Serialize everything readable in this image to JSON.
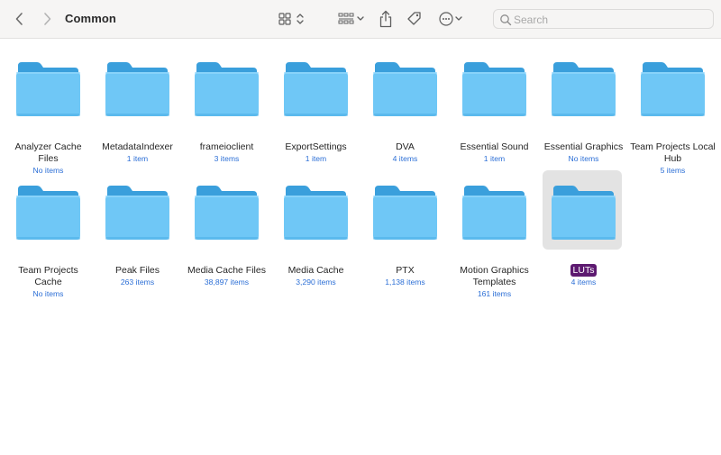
{
  "toolbar": {
    "title": "Common",
    "search_placeholder": "Search",
    "icons": {
      "back": "chevron-left-icon",
      "forward": "chevron-right-icon",
      "view": "grid-view-icon",
      "group": "group-by-icon",
      "share": "share-icon",
      "tag": "tag-icon",
      "more": "ellipsis-circle-icon",
      "search": "search-icon"
    }
  },
  "colors": {
    "folder_front": "#6fc7f6",
    "folder_back": "#3a9fdc",
    "count_text": "#2c6fd6",
    "selection_label": "#5d1a70"
  },
  "folders": [
    {
      "name": "Analyzer Cache Files",
      "count": "No items"
    },
    {
      "name": "MetadataIndexer",
      "count": "1 item"
    },
    {
      "name": "frameioclient",
      "count": "3 items"
    },
    {
      "name": "ExportSettings",
      "count": "1 item"
    },
    {
      "name": "DVA",
      "count": "4 items"
    },
    {
      "name": "Essential Sound",
      "count": "1 item"
    },
    {
      "name": "Essential Graphics",
      "count": "No items"
    },
    {
      "name": "Team Projects Local Hub",
      "count": "5 items"
    },
    {
      "name": "Team Projects Cache",
      "count": "No items"
    },
    {
      "name": "Peak Files",
      "count": "263 items"
    },
    {
      "name": "Media Cache Files",
      "count": "38,897 items"
    },
    {
      "name": "Media Cache",
      "count": "3,290 items"
    },
    {
      "name": "PTX",
      "count": "1,138 items"
    },
    {
      "name": "Motion Graphics Templates",
      "count": "161 items"
    },
    {
      "name": "LUTs",
      "count": "4 items",
      "selected": true
    }
  ]
}
